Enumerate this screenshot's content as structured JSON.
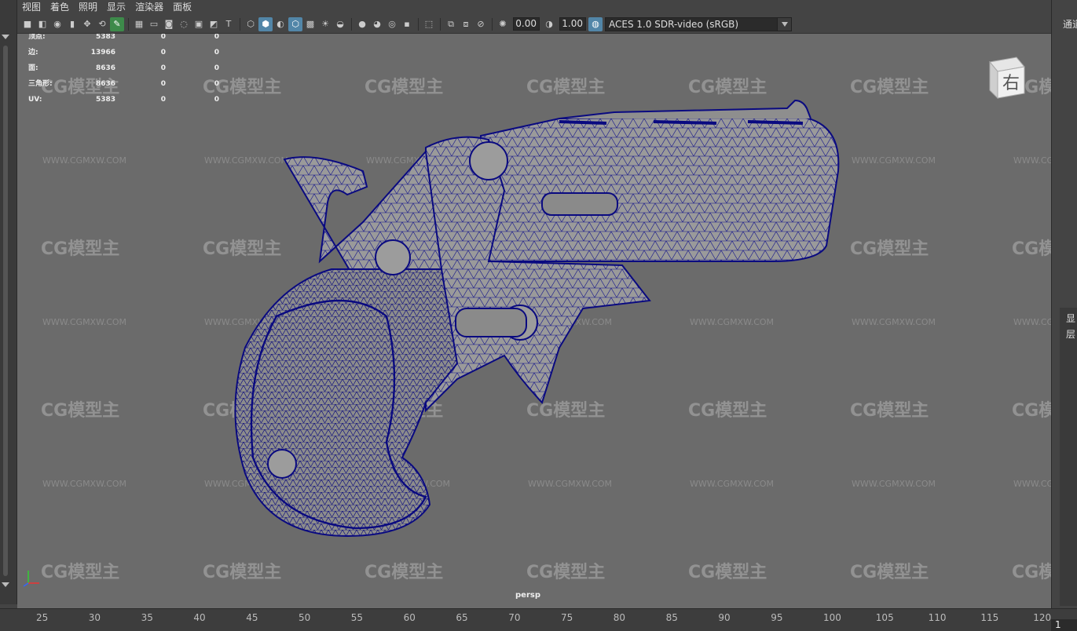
{
  "menu": [
    "视图",
    "着色",
    "照明",
    "显示",
    "渲染器",
    "面板"
  ],
  "toolbar": {
    "icons": [
      "camera-icon",
      "camera-attr-icon",
      "bookmark-icon",
      "image-plane-icon",
      "2d-pan-icon",
      "grease-pencil-icon",
      "grid-icon",
      "film-gate-icon",
      "resolution-gate-icon",
      "gate-mask-icon",
      "field-chart-icon",
      "safe-action-icon",
      "safe-title-icon",
      "wireframe-icon",
      "smooth-shade-icon",
      "default-material-icon",
      "wireframe-on-shaded-icon",
      "xray-icon",
      "use-lights-icon",
      "shadows-icon",
      "ao-icon",
      "motion-blur-icon",
      "aa-icon",
      "dof-icon",
      "isolate-icon",
      "xray-joints-icon",
      "xray-active-icon",
      "backface-icon",
      "exposure-icon",
      "gamma-icon",
      "color-management-icon"
    ],
    "exposure_value": "0.00",
    "gamma_value": "1.00",
    "color_space": "ACES 1.0 SDR-video (sRGB)"
  },
  "hud": {
    "rows": [
      {
        "label": "顶点:",
        "v1": "5383",
        "v2": "0",
        "v3": "0"
      },
      {
        "label": "边:",
        "v1": "13966",
        "v2": "0",
        "v3": "0"
      },
      {
        "label": "面:",
        "v1": "8636",
        "v2": "0",
        "v3": "0"
      },
      {
        "label": "三角形:",
        "v1": "8636",
        "v2": "0",
        "v3": "0"
      },
      {
        "label": "UV:",
        "v1": "5383",
        "v2": "0",
        "v3": "0"
      }
    ]
  },
  "watermark": {
    "logo": "CG模型主",
    "url": "WWW.CGMXW.COM"
  },
  "camera_label": "persp",
  "view_cube_label": "右",
  "right_panel": {
    "tab_top": "通道",
    "side_labels": [
      "显",
      "层"
    ]
  },
  "timeline": {
    "ticks": [
      "25",
      "30",
      "35",
      "40",
      "45",
      "50",
      "55",
      "60",
      "65",
      "70",
      "75",
      "80",
      "85",
      "90",
      "95",
      "100",
      "105",
      "110",
      "115",
      "120"
    ],
    "current_frame": "1"
  },
  "colors": {
    "wire": "#0a0a80",
    "viewport_bg": "#6b6b6b",
    "mesh_fill": "#9a9a9a"
  }
}
